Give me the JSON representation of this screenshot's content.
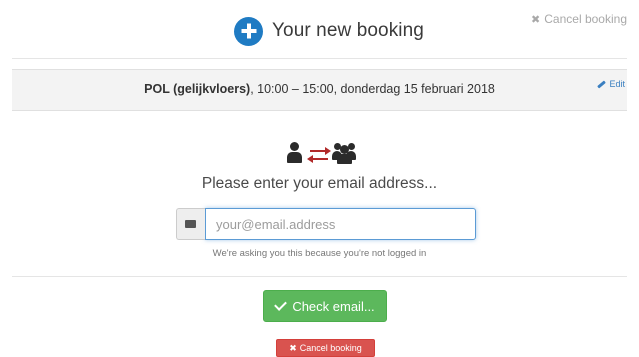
{
  "header": {
    "title": "Your new booking",
    "cancel_link": "Cancel booking"
  },
  "summary": {
    "room": "POL (gelijkvloers)",
    "details": ", 10:00 – 15:00, donderdag 15 februari 2018",
    "edit_label": "Edit"
  },
  "form": {
    "prompt": "Please enter your email address...",
    "email_placeholder": "your@email.address",
    "email_value": "",
    "helper_text": "We're asking you this because you're not logged in",
    "check_button": "Check email...",
    "cancel_button": "Cancel booking"
  },
  "colors": {
    "accent_blue": "#1f7bc3",
    "success_green": "#5cb85c",
    "danger_red": "#d9534f",
    "swap_red": "#b12a2a"
  },
  "icons": {
    "title": "plus-circle-icon",
    "cancel": "close-icon",
    "edit": "pencil-icon",
    "user": "user-icon",
    "swap": "exchange-icon",
    "users": "users-icon",
    "email": "envelope-icon",
    "check": "check-icon"
  }
}
